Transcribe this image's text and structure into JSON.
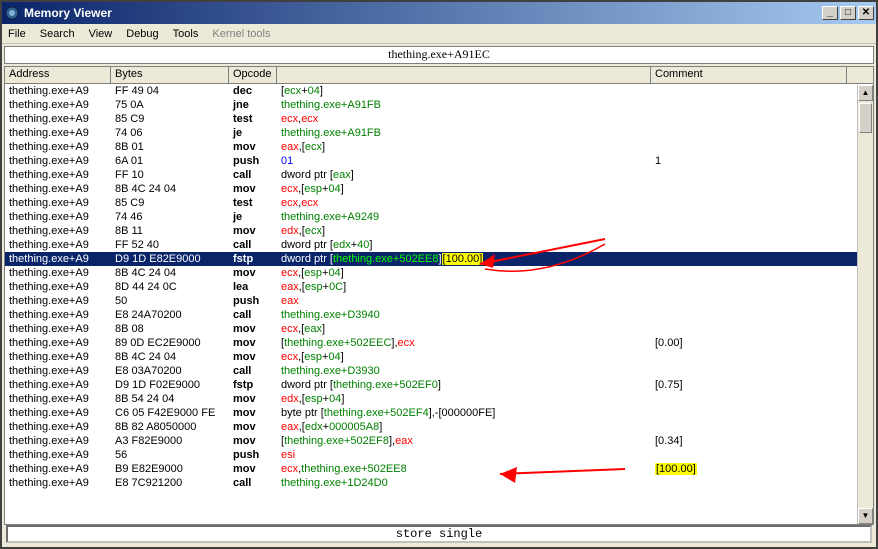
{
  "window": {
    "title": "Memory Viewer"
  },
  "menubar": [
    "File",
    "Search",
    "View",
    "Debug",
    "Tools",
    "Kernel tools"
  ],
  "menubar_disabled_index": 5,
  "location": "thething.exe+A91EC",
  "headers": {
    "address": "Address",
    "bytes": "Bytes",
    "opcode": "Opcode",
    "comment": "Comment"
  },
  "status": "store single",
  "rows": [
    {
      "addr": "thething.exe+A9",
      "bytes": "FF 49 04",
      "op": "dec",
      "oper": [
        {
          "t": "[",
          "c": "k"
        },
        {
          "t": "ecx",
          "c": "g"
        },
        {
          "t": "+",
          "c": "k"
        },
        {
          "t": "04",
          "c": "g"
        },
        {
          "t": "]",
          "c": "k"
        }
      ],
      "cmt": ""
    },
    {
      "addr": "thething.exe+A9",
      "bytes": "75 0A",
      "op": "jne",
      "oper": [
        {
          "t": "thething.exe+A91FB",
          "c": "g"
        }
      ],
      "cmt": ""
    },
    {
      "addr": "thething.exe+A9",
      "bytes": "85 C9",
      "op": "test",
      "oper": [
        {
          "t": "ecx",
          "c": "r"
        },
        {
          "t": ",",
          "c": "k"
        },
        {
          "t": "ecx",
          "c": "r"
        }
      ],
      "cmt": ""
    },
    {
      "addr": "thething.exe+A9",
      "bytes": "74 06",
      "op": "je",
      "oper": [
        {
          "t": "thething.exe+A91FB",
          "c": "g"
        }
      ],
      "cmt": ""
    },
    {
      "addr": "thething.exe+A9",
      "bytes": "8B 01",
      "op": "mov",
      "oper": [
        {
          "t": "eax",
          "c": "r"
        },
        {
          "t": ",[",
          "c": "k"
        },
        {
          "t": "ecx",
          "c": "g"
        },
        {
          "t": "]",
          "c": "k"
        }
      ],
      "cmt": ""
    },
    {
      "addr": "thething.exe+A9",
      "bytes": "6A 01",
      "op": "push",
      "oper": [
        {
          "t": "01",
          "c": "b"
        }
      ],
      "cmt": "1"
    },
    {
      "addr": "thething.exe+A9",
      "bytes": "FF 10",
      "op": "call",
      "oper": [
        {
          "t": "dword ptr [",
          "c": "k"
        },
        {
          "t": "eax",
          "c": "g"
        },
        {
          "t": "]",
          "c": "k"
        }
      ],
      "cmt": ""
    },
    {
      "addr": "thething.exe+A9",
      "bytes": "8B 4C 24 04",
      "op": "mov",
      "marker": "arrow",
      "oper": [
        {
          "t": "ecx",
          "c": "r"
        },
        {
          "t": ",[",
          "c": "k"
        },
        {
          "t": "esp",
          "c": "g"
        },
        {
          "t": "+",
          "c": "k"
        },
        {
          "t": "04",
          "c": "g"
        },
        {
          "t": "]",
          "c": "k"
        }
      ],
      "cmt": ""
    },
    {
      "addr": "thething.exe+A9",
      "bytes": "85 C9",
      "op": "test",
      "oper": [
        {
          "t": "ecx",
          "c": "r"
        },
        {
          "t": ",",
          "c": "k"
        },
        {
          "t": "ecx",
          "c": "r"
        }
      ],
      "cmt": ""
    },
    {
      "addr": "thething.exe+A9",
      "bytes": "74 46",
      "op": "je",
      "oper": [
        {
          "t": "thething.exe+A9249",
          "c": "g"
        }
      ],
      "cmt": ""
    },
    {
      "addr": "thething.exe+A9",
      "bytes": "8B 11",
      "op": "mov",
      "oper": [
        {
          "t": "edx",
          "c": "r"
        },
        {
          "t": ",[",
          "c": "k"
        },
        {
          "t": "ecx",
          "c": "g"
        },
        {
          "t": "]",
          "c": "k"
        }
      ],
      "cmt": ""
    },
    {
      "addr": "thething.exe+A9",
      "bytes": "FF 52 40",
      "op": "call",
      "oper": [
        {
          "t": "dword ptr [",
          "c": "k"
        },
        {
          "t": "edx",
          "c": "g"
        },
        {
          "t": "+",
          "c": "k"
        },
        {
          "t": "40",
          "c": "g"
        },
        {
          "t": "]",
          "c": "k"
        }
      ],
      "cmt": ""
    },
    {
      "addr": "thething.exe+A9",
      "bytes": "D9 1D E82E9000",
      "op": "fstp",
      "sel": true,
      "oper": [
        {
          "t": "dword ptr [",
          "c": "k"
        },
        {
          "t": "thething.exe+502EE8",
          "c": "g"
        },
        {
          "t": "]",
          "c": "k"
        },
        {
          "t": "[100.00]",
          "c": "hl"
        }
      ],
      "cmt": ""
    },
    {
      "addr": "thething.exe+A9",
      "bytes": "8B 4C 24 04",
      "op": "mov",
      "oper": [
        {
          "t": "ecx",
          "c": "r"
        },
        {
          "t": ",[",
          "c": "k"
        },
        {
          "t": "esp",
          "c": "g"
        },
        {
          "t": "+",
          "c": "k"
        },
        {
          "t": "04",
          "c": "g"
        },
        {
          "t": "]",
          "c": "k"
        }
      ],
      "cmt": ""
    },
    {
      "addr": "thething.exe+A9",
      "bytes": "8D 44 24 0C",
      "op": "lea",
      "oper": [
        {
          "t": "eax",
          "c": "r"
        },
        {
          "t": ",[",
          "c": "k"
        },
        {
          "t": "esp",
          "c": "g"
        },
        {
          "t": "+",
          "c": "k"
        },
        {
          "t": "0C",
          "c": "g"
        },
        {
          "t": "]",
          "c": "k"
        }
      ],
      "cmt": ""
    },
    {
      "addr": "thething.exe+A9",
      "bytes": "50",
      "op": "push",
      "oper": [
        {
          "t": "eax",
          "c": "r"
        }
      ],
      "cmt": ""
    },
    {
      "addr": "thething.exe+A9",
      "bytes": "E8 24A70200",
      "op": "call",
      "oper": [
        {
          "t": "thething.exe+D3940",
          "c": "g"
        }
      ],
      "cmt": ""
    },
    {
      "addr": "thething.exe+A9",
      "bytes": "8B 08",
      "op": "mov",
      "oper": [
        {
          "t": "ecx",
          "c": "r"
        },
        {
          "t": ",[",
          "c": "k"
        },
        {
          "t": "eax",
          "c": "g"
        },
        {
          "t": "]",
          "c": "k"
        }
      ],
      "cmt": ""
    },
    {
      "addr": "thething.exe+A9",
      "bytes": "89 0D EC2E9000",
      "op": "mov",
      "oper": [
        {
          "t": "[",
          "c": "k"
        },
        {
          "t": "thething.exe+502EEC",
          "c": "g"
        },
        {
          "t": "],",
          "c": "k"
        },
        {
          "t": "ecx",
          "c": "r"
        }
      ],
      "cmt": "[0.00]"
    },
    {
      "addr": "thething.exe+A9",
      "bytes": "8B 4C 24 04",
      "op": "mov",
      "oper": [
        {
          "t": "ecx",
          "c": "r"
        },
        {
          "t": ",[",
          "c": "k"
        },
        {
          "t": "esp",
          "c": "g"
        },
        {
          "t": "+",
          "c": "k"
        },
        {
          "t": "04",
          "c": "g"
        },
        {
          "t": "]",
          "c": "k"
        }
      ],
      "cmt": ""
    },
    {
      "addr": "thething.exe+A9",
      "bytes": "E8 03A70200",
      "op": "call",
      "oper": [
        {
          "t": "thething.exe+D3930",
          "c": "g"
        }
      ],
      "cmt": ""
    },
    {
      "addr": "thething.exe+A9",
      "bytes": "D9 1D F02E9000",
      "op": "fstp",
      "oper": [
        {
          "t": "dword ptr [",
          "c": "k"
        },
        {
          "t": "thething.exe+502EF0",
          "c": "g"
        },
        {
          "t": "]",
          "c": "k"
        }
      ],
      "cmt": "[0.75]"
    },
    {
      "addr": "thething.exe+A9",
      "bytes": "8B 54 24 04",
      "op": "mov",
      "oper": [
        {
          "t": "edx",
          "c": "r"
        },
        {
          "t": ",[",
          "c": "k"
        },
        {
          "t": "esp",
          "c": "g"
        },
        {
          "t": "+",
          "c": "k"
        },
        {
          "t": "04",
          "c": "g"
        },
        {
          "t": "]",
          "c": "k"
        }
      ],
      "cmt": ""
    },
    {
      "addr": "thething.exe+A9",
      "bytes": "C6 05 F42E9000 FE",
      "op": "mov",
      "oper": [
        {
          "t": "byte ptr [",
          "c": "k"
        },
        {
          "t": "thething.exe+502EF4",
          "c": "g"
        },
        {
          "t": "],-[",
          "c": "k"
        },
        {
          "t": "000000FE",
          "c": "k"
        },
        {
          "t": "]",
          "c": "k"
        }
      ],
      "cmt": ""
    },
    {
      "addr": "thething.exe+A9",
      "bytes": "8B 82 A8050000",
      "op": "mov",
      "oper": [
        {
          "t": "eax",
          "c": "r"
        },
        {
          "t": ",[",
          "c": "k"
        },
        {
          "t": "edx",
          "c": "g"
        },
        {
          "t": "+",
          "c": "k"
        },
        {
          "t": "000005A8",
          "c": "g"
        },
        {
          "t": "]",
          "c": "k"
        }
      ],
      "cmt": ""
    },
    {
      "addr": "thething.exe+A9",
      "bytes": "A3 F82E9000",
      "op": "mov",
      "oper": [
        {
          "t": "[",
          "c": "k"
        },
        {
          "t": "thething.exe+502EF8",
          "c": "g"
        },
        {
          "t": "],",
          "c": "k"
        },
        {
          "t": "eax",
          "c": "r"
        }
      ],
      "cmt": "[0.34]"
    },
    {
      "addr": "thething.exe+A9",
      "bytes": "56",
      "op": "push",
      "marker": "arrow",
      "oper": [
        {
          "t": "esi",
          "c": "r"
        }
      ],
      "cmt": ""
    },
    {
      "addr": "thething.exe+A9",
      "bytes": "B9 E82E9000",
      "op": "mov",
      "oper": [
        {
          "t": "ecx",
          "c": "r"
        },
        {
          "t": ",",
          "c": "k"
        },
        {
          "t": "thething.exe+502EE8",
          "c": "g"
        }
      ],
      "cmt": "[100.00]",
      "cmthl": true
    },
    {
      "addr": "thething.exe+A9",
      "bytes": "E8 7C921200",
      "op": "call",
      "oper": [
        {
          "t": "thething.exe+1D24D0",
          "c": "g"
        }
      ],
      "cmt": ""
    }
  ]
}
